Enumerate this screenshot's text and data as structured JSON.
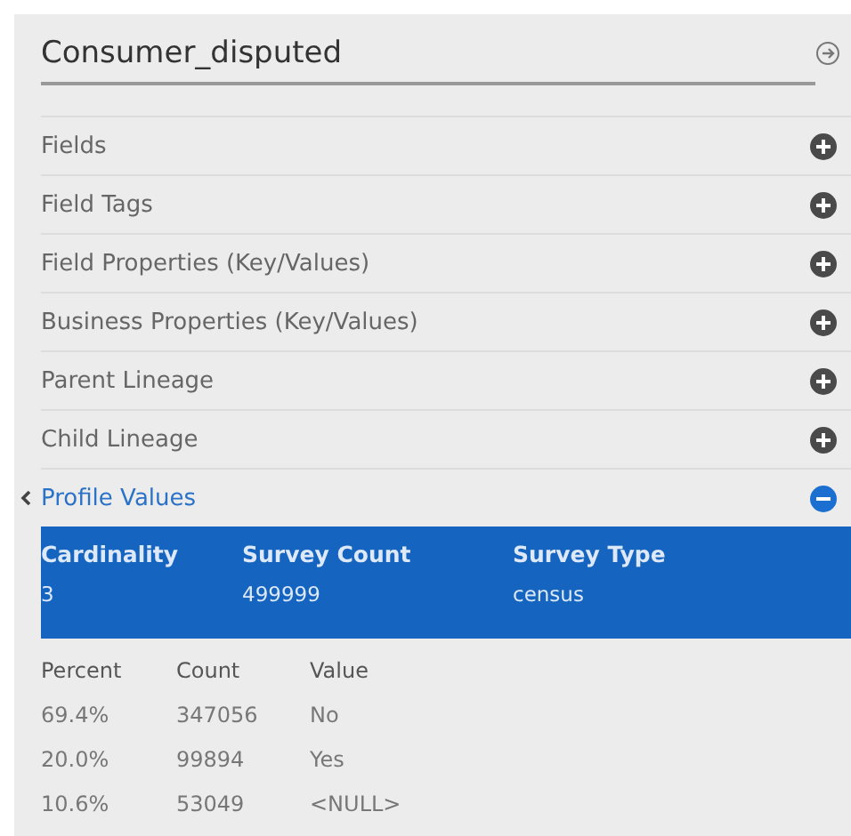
{
  "title": "Consumer_disputed",
  "sections": [
    {
      "label": "Fields",
      "expanded": false
    },
    {
      "label": "Field Tags",
      "expanded": false
    },
    {
      "label": "Field Properties (Key/Values)",
      "expanded": false
    },
    {
      "label": "Business Properties (Key/Values)",
      "expanded": false
    },
    {
      "label": "Parent Lineage",
      "expanded": false
    },
    {
      "label": "Child Lineage",
      "expanded": false
    },
    {
      "label": "Profile Values",
      "expanded": true
    }
  ],
  "summary": [
    {
      "heading": "Cardinality",
      "value": "3"
    },
    {
      "heading": "Survey Count",
      "value": "499999"
    },
    {
      "heading": "Survey Type",
      "value": "census"
    }
  ],
  "table": {
    "columns": [
      "Percent",
      "Count",
      "Value"
    ],
    "rows": [
      [
        "69.4%",
        "347056",
        "No"
      ],
      [
        "20.0%",
        "99894",
        "Yes"
      ],
      [
        "10.6%",
        "53049",
        "<NULL>"
      ]
    ]
  }
}
